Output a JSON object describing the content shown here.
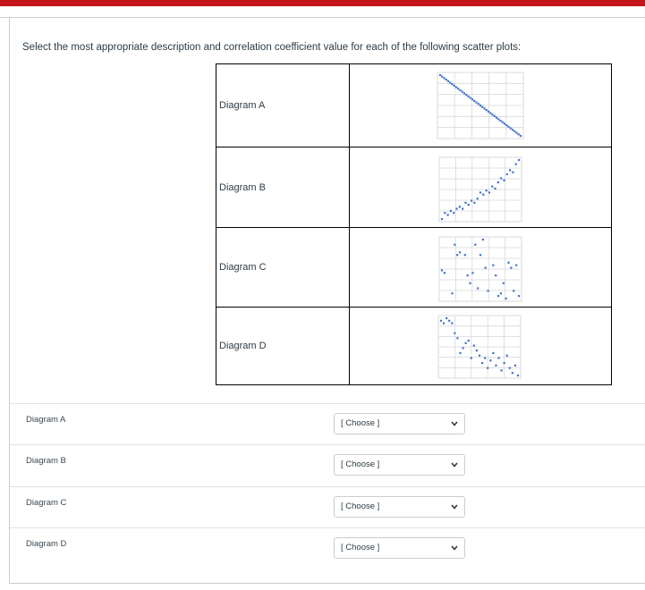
{
  "question": {
    "prompt": "Select the most appropriate description and correlation coefficient value for each of the following scatter plots:"
  },
  "diagrams": [
    {
      "label": "Diagram A"
    },
    {
      "label": "Diagram B"
    },
    {
      "label": "Diagram C"
    },
    {
      "label": "Diagram D"
    }
  ],
  "answers": [
    {
      "label": "Diagram A",
      "select_value": "[ Choose ]"
    },
    {
      "label": "Diagram B",
      "select_value": "[ Choose ]"
    },
    {
      "label": "Diagram C",
      "select_value": "[ Choose ]"
    },
    {
      "label": "Diagram D",
      "select_value": "[ Choose ]"
    }
  ],
  "icons": {
    "select_arrow": "chevron-down-icon"
  },
  "colors": {
    "accent_bar": "#c4161c",
    "point": "#4472c4",
    "grid": "#d9d9d9"
  },
  "chart_data": [
    {
      "type": "scatter",
      "series": [
        {
          "x": [
            0,
            1,
            2,
            3,
            4,
            5,
            6,
            7,
            8,
            9,
            10,
            11,
            12,
            13,
            14,
            15,
            16,
            17,
            18,
            19,
            20,
            21,
            22,
            23,
            24,
            25,
            26,
            27,
            28,
            29,
            30,
            31,
            32,
            33,
            34,
            35,
            36,
            37,
            38,
            39,
            40
          ],
          "y": [
            40,
            39,
            38,
            37,
            36,
            35,
            34,
            33,
            32,
            31,
            30,
            29,
            28,
            27,
            26,
            25,
            24,
            23,
            22,
            21,
            20,
            19,
            18,
            17,
            16,
            15,
            14,
            13,
            12,
            11,
            10,
            9,
            8,
            7,
            6,
            5,
            4,
            3,
            2,
            1,
            0
          ]
        }
      ]
    },
    {
      "type": "scatter",
      "series": [
        {
          "x": [
            0,
            1,
            2,
            3,
            4,
            5,
            6,
            7,
            8,
            9,
            10,
            11,
            12,
            13,
            14,
            15,
            16,
            17,
            18,
            19,
            20,
            21,
            22,
            23,
            24,
            25,
            26
          ],
          "y": [
            0,
            3,
            2,
            4,
            3,
            5,
            6,
            5,
            8,
            7,
            9,
            8,
            10,
            13,
            12,
            14,
            13,
            16,
            15,
            18,
            20,
            19,
            22,
            24,
            23,
            27,
            29
          ]
        }
      ]
    },
    {
      "type": "scatter",
      "series": [
        {
          "x": [
            0,
            1,
            4,
            5,
            6,
            7,
            9,
            10,
            11,
            12,
            13,
            14,
            15,
            16,
            17,
            18,
            20,
            21,
            22,
            23,
            24,
            25,
            26,
            27,
            28,
            29,
            30
          ],
          "y": [
            14,
            13,
            5,
            24,
            20,
            21,
            20,
            12,
            9,
            13,
            24,
            7,
            20,
            26,
            15,
            6,
            16,
            12,
            4,
            5,
            9,
            3,
            17,
            15,
            6,
            16,
            4
          ]
        }
      ]
    },
    {
      "type": "scatter",
      "series": [
        {
          "x": [
            0,
            1,
            2,
            3,
            4,
            5,
            6,
            7,
            8,
            9,
            10,
            11,
            12,
            13,
            14,
            15,
            16,
            17,
            18,
            19,
            20,
            21,
            22,
            23,
            24,
            25,
            26,
            27,
            28
          ],
          "y": [
            27,
            26,
            28,
            27,
            26,
            22,
            20,
            14,
            16,
            18,
            19,
            12,
            17,
            15,
            13,
            10,
            12,
            8,
            11,
            14,
            9,
            12,
            7,
            10,
            13,
            8,
            6,
            9,
            5
          ]
        }
      ]
    }
  ]
}
